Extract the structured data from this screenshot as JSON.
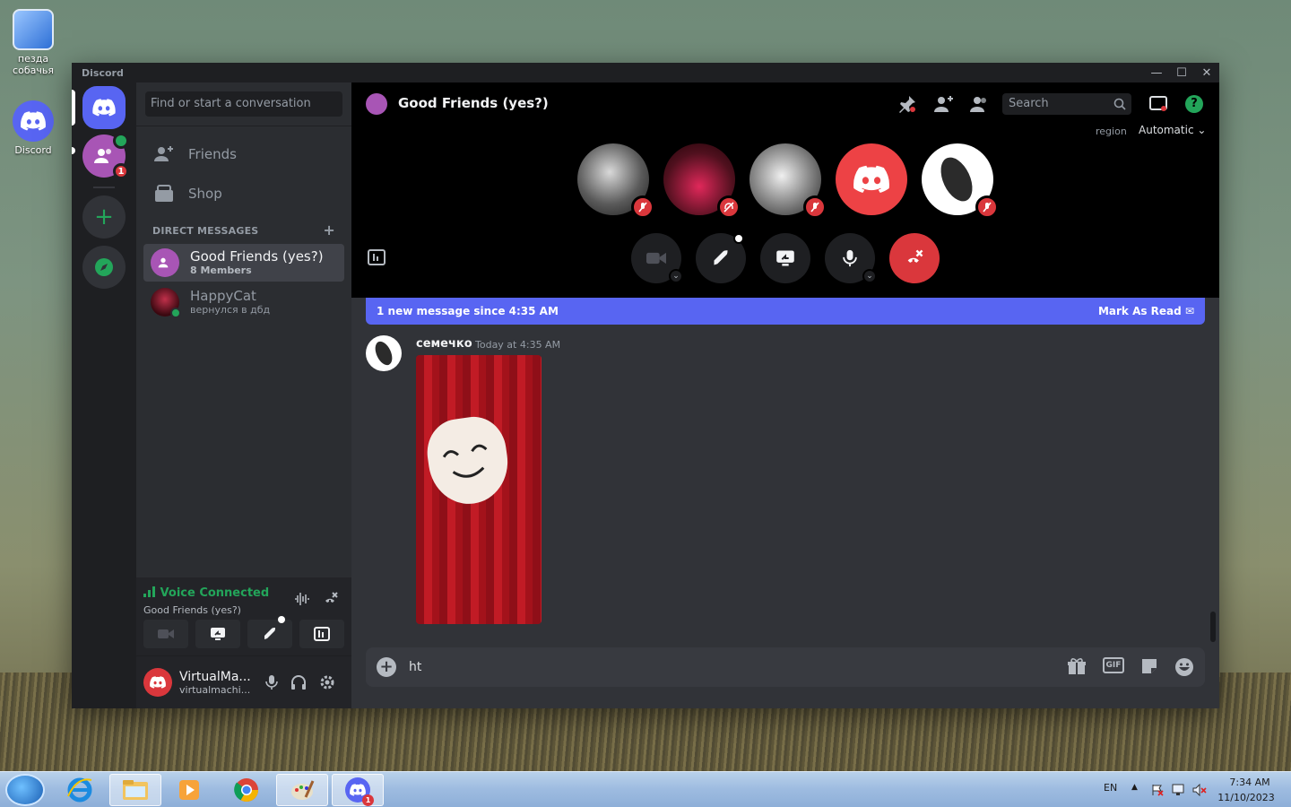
{
  "desktop": {
    "icons": [
      {
        "label": "пезда\nсобачья"
      },
      {
        "label": "Discord"
      }
    ]
  },
  "window": {
    "app_title": "Discord",
    "controls": {
      "minimize": "—",
      "maximize": "☐",
      "close": "✕"
    }
  },
  "rail": {
    "badge": "1"
  },
  "sidebar": {
    "search_placeholder": "Find or start a conversation",
    "nav": [
      {
        "label": "Friends",
        "icon": "friends-icon"
      },
      {
        "label": "Shop",
        "icon": "shop-icon"
      }
    ],
    "dm_header": "DIRECT MESSAGES",
    "dms": [
      {
        "name": "Good Friends (yes?)",
        "sub": "8 Members",
        "active": true
      },
      {
        "name": "HappyCat",
        "sub": "вернулся в дбд",
        "active": false
      }
    ],
    "voice": {
      "status": "Voice Connected",
      "channel": "Good Friends (yes?)"
    },
    "user": {
      "name": "VirtualMa...",
      "tag": "virtualmachi..."
    }
  },
  "main": {
    "title": "Good Friends (yes?)",
    "search_placeholder": "Search",
    "region_label": "region",
    "region_value": "Automatic",
    "banner": {
      "text": "1 new message since 4:35 AM",
      "action": "Mark As Read"
    },
    "message": {
      "author": "семечко",
      "time": "Today at 4:35 AM"
    },
    "composer_value": "ht"
  },
  "taskbar": {
    "lang": "EN",
    "time": "7:34 AM",
    "date": "11/10/2023",
    "discord_badge": "1"
  },
  "colors": {
    "blurple": "#5865f2",
    "danger": "#da373c",
    "online": "#23a55a"
  }
}
